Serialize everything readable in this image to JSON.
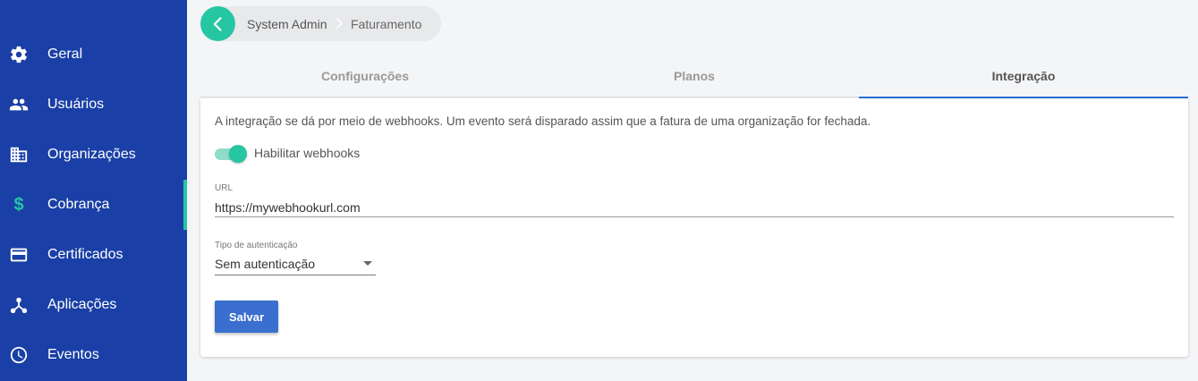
{
  "sidebar": {
    "items": [
      {
        "label": "Geral",
        "icon": "gear-icon"
      },
      {
        "label": "Usuários",
        "icon": "users-icon"
      },
      {
        "label": "Organizações",
        "icon": "building-icon"
      },
      {
        "label": "Cobrança",
        "icon": "dollar-icon",
        "active": true
      },
      {
        "label": "Certificados",
        "icon": "credit-card-icon"
      },
      {
        "label": "Aplicações",
        "icon": "hub-icon"
      },
      {
        "label": "Eventos",
        "icon": "clock-icon"
      }
    ],
    "active_color": "#26c6a2",
    "background": "#1a3fa6"
  },
  "breadcrumb": {
    "items": [
      "System Admin",
      "Faturamento"
    ]
  },
  "tabs": [
    {
      "label": "Configurações"
    },
    {
      "label": "Planos"
    },
    {
      "label": "Integração",
      "active": true
    }
  ],
  "integration": {
    "description": "A integração se dá por meio de webhooks. Um evento será disparado assim que a fatura de uma organização for fechada.",
    "toggle_label": "Habilitar webhooks",
    "toggle_on": true,
    "url_label": "URL",
    "url_value": "https://mywebhookurl.com",
    "auth_label": "Tipo de autenticação",
    "auth_value": "Sem autenticação",
    "save_label": "Salvar"
  }
}
